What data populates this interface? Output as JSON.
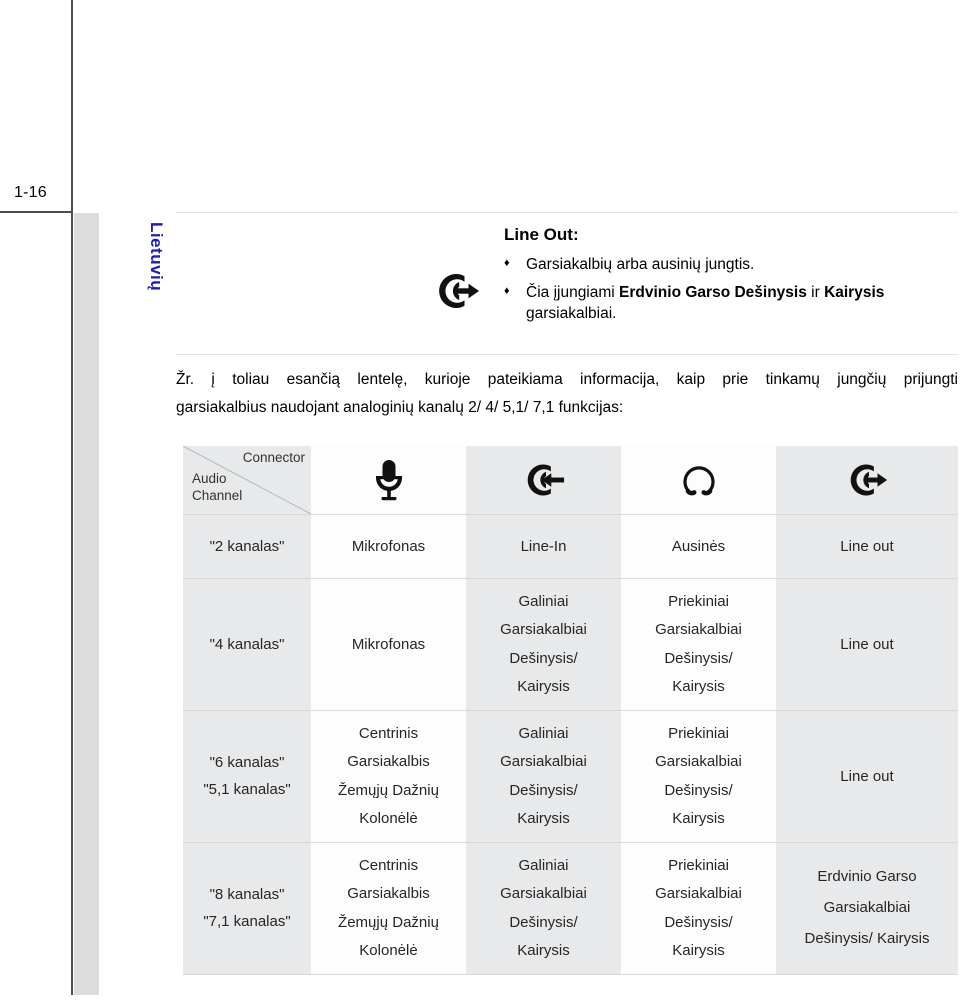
{
  "page": {
    "number": "1-16",
    "language_tab": "Lietuvių",
    "language_tab_color": "#1b1bb5",
    "tab_background": "#dddddd"
  },
  "callout": {
    "icon": "line-out-icon",
    "title": "Line Out:",
    "bullet_mark": "♦",
    "bullets": [
      {
        "pre": "Garsiakalbių arba ausinių jungtis.",
        "bold1": "",
        "mid": "",
        "bold2": "",
        "post": ""
      },
      {
        "pre": "Čia įjungiami ",
        "bold1": "Erdvinio Garso Dešinysis",
        "mid": " ir ",
        "bold2": "Kairysis",
        "post": " garsiakalbiai."
      }
    ]
  },
  "intro": {
    "line1": "Žr. į toliau esančią lentelę, kurioje pateikiama informacija, kaip prie tinkamų jungčių prijungti",
    "line2": "garsiakalbius naudojant analoginių kanalų 2/ 4/ 5,1/ 7,1 funkcijas:"
  },
  "table": {
    "corner": {
      "connector_label": "Connector",
      "audio_channel_label_1": "Audio",
      "audio_channel_label_2": "Channel"
    },
    "header_icons": [
      "microphone-icon",
      "line-in-icon",
      "headphone-icon",
      "line-out-icon"
    ],
    "rows": [
      {
        "channel": [
          "\"2 kanalas\""
        ],
        "cells": [
          [
            "Mikrofonas"
          ],
          [
            "Line-In"
          ],
          [
            "Ausinės"
          ],
          [
            "Line out"
          ]
        ]
      },
      {
        "channel": [
          "\"4 kanalas\""
        ],
        "cells": [
          [
            "Mikrofonas"
          ],
          [
            "Galiniai",
            "Garsiakalbiai",
            "Dešinysis/",
            "Kairysis"
          ],
          [
            "Priekiniai",
            "Garsiakalbiai",
            "Dešinysis/",
            "Kairysis"
          ],
          [
            "Line out"
          ]
        ]
      },
      {
        "channel": [
          "\"6 kanalas\"",
          "\"5,1 kanalas\""
        ],
        "cells": [
          [
            "Centrinis",
            "Garsiakalbis",
            "Žemųjų Dažnių",
            "Kolonėlė"
          ],
          [
            "Galiniai",
            "Garsiakalbiai",
            "Dešinysis/",
            "Kairysis"
          ],
          [
            "Priekiniai",
            "Garsiakalbiai",
            "Dešinysis/",
            "Kairysis"
          ],
          [
            "Line out"
          ]
        ]
      },
      {
        "channel": [
          "\"8 kanalas\"",
          "\"7,1 kanalas\""
        ],
        "cells": [
          [
            "Centrinis",
            "Garsiakalbis",
            "Žemųjų Dažnių",
            "Kolonėlė"
          ],
          [
            "Galiniai",
            "Garsiakalbiai",
            "Dešinysis/",
            "Kairysis"
          ],
          [
            "Priekiniai",
            "Garsiakalbiai",
            "Dešinysis/",
            "Kairysis"
          ],
          [
            "Erdvinio Garso",
            "Garsiakalbiai",
            "Dešinysis/ Kairysis"
          ]
        ]
      }
    ]
  }
}
